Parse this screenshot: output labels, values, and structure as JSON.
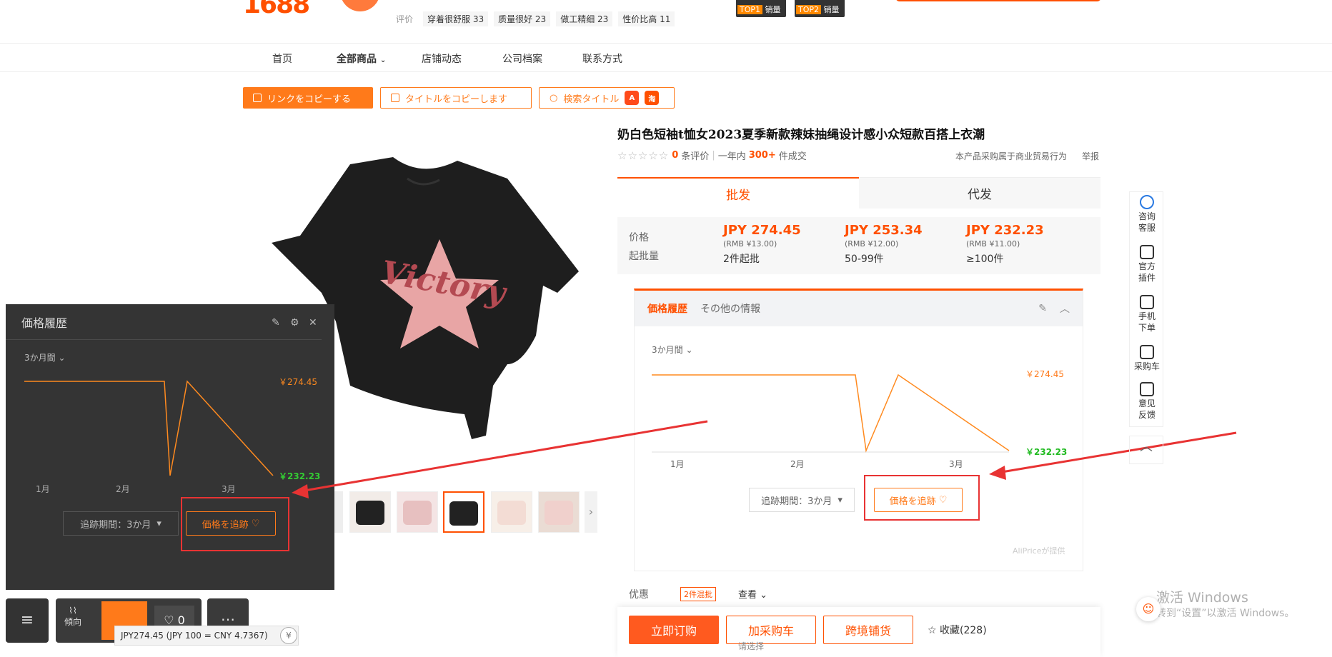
{
  "header": {
    "logo_partial": "1688",
    "ratings_label": "评价",
    "rating_tags": [
      "穿着很舒服 33",
      "质量很好 23",
      "做工精细 23",
      "性价比高 11"
    ],
    "badges": [
      {
        "rank": "TOP1",
        "text": "销量"
      },
      {
        "rank": "TOP2",
        "text": "销量"
      }
    ]
  },
  "nav": {
    "items": [
      "首页",
      "全部商品",
      "店铺动态",
      "公司档案",
      "联系方式"
    ]
  },
  "actions": {
    "copy_link": "リンクをコピーする",
    "copy_title": "タイトルをコピーします",
    "search_title": "検索タイトル",
    "logo_a": "aliexpress",
    "logo_b": "淘"
  },
  "product": {
    "title": "奶白色短袖t恤女2023夏季新款辣妹抽绳设计感小众短款百搭上衣潮",
    "reviews_count": "0",
    "reviews_label": "条评价",
    "sales_prefix": "一年内",
    "sales_count": "300+",
    "sales_suffix": "件成交",
    "legal_note": "本产品采购属于商业贸易行为",
    "report": "举报",
    "image_text": "Victory",
    "tabs": [
      "批发",
      "代发"
    ],
    "price_label": "价格",
    "moq_label": "起批量",
    "tiers": [
      {
        "price": "JPY 274.45",
        "rmb": "(RMB ¥13.00)",
        "qty": "2件起批"
      },
      {
        "price": "JPY 253.34",
        "rmb": "(RMB ¥12.00)",
        "qty": "50-99件"
      },
      {
        "price": "JPY 232.23",
        "rmb": "(RMB ¥11.00)",
        "qty": "≥100件"
      }
    ]
  },
  "price_panel": {
    "tab_history": "価格履歴",
    "tab_other": "その他の情報",
    "period": "3か月間",
    "high_label": "￥274.45",
    "low_label": "￥232.23",
    "months": [
      "1月",
      "2月",
      "3月"
    ],
    "track_period": "追跡期間：3か月",
    "track_button": "価格を追跡",
    "provider": "AliPriceが提供",
    "chart_series": [
      274.45,
      274.45,
      274.45,
      232.23,
      274.45,
      232.23
    ]
  },
  "dark_panel": {
    "title": "価格履歴",
    "period": "3か月間",
    "high_label": "￥274.45",
    "low_label": "￥232.23",
    "months": [
      "1月",
      "2月",
      "3月"
    ],
    "track_period": "追跡期間：3か月",
    "track_button": "価格を追跡"
  },
  "sidebar": {
    "items": [
      "咨询\n客服",
      "官方\n插件",
      "手机\n下单",
      "采购车",
      "意见\n反馈"
    ]
  },
  "bottom": {
    "promo_label": "优惠",
    "promo_tag": "2件混批",
    "promo_view": "查看",
    "buy_now": "立即订购",
    "add_cart": "加采购车",
    "cross_border": "跨境铺货",
    "favorite": "收藏(228)",
    "select_hint": "请选择"
  },
  "dock": {
    "trend": "傾向",
    "likes": "0",
    "rate": "JPY274.45 (JPY 100 = CNY 4.7367)"
  },
  "watermark": {
    "line1": "激活 Windows",
    "line2": "转到“设置”以激活 Windows。"
  },
  "colors": {
    "accent": "#ff5000",
    "aliprice_orange": "#ff7a1a",
    "low_green": "#22bb22",
    "annotation_red": "#e83333"
  }
}
